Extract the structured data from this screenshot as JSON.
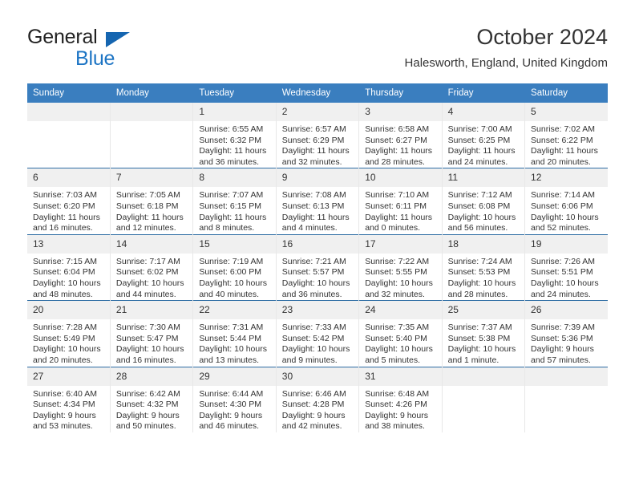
{
  "brand": {
    "name_part1": "General",
    "name_part2": "Blue",
    "triangle_color": "#1565b0",
    "blue_color": "#1c74c4"
  },
  "header": {
    "title": "October 2024",
    "subtitle": "Halesworth, England, United Kingdom",
    "header_bg": "#3a7ebf",
    "row_rule_color": "#2e6da4",
    "daynum_bg": "#f0f0f0"
  },
  "weekdays": [
    "Sunday",
    "Monday",
    "Tuesday",
    "Wednesday",
    "Thursday",
    "Friday",
    "Saturday"
  ],
  "weeks": [
    [
      {
        "day": "",
        "empty": true
      },
      {
        "day": "",
        "empty": true
      },
      {
        "day": "1",
        "sunrise": "Sunrise: 6:55 AM",
        "sunset": "Sunset: 6:32 PM",
        "daylight1": "Daylight: 11 hours",
        "daylight2": "and 36 minutes."
      },
      {
        "day": "2",
        "sunrise": "Sunrise: 6:57 AM",
        "sunset": "Sunset: 6:29 PM",
        "daylight1": "Daylight: 11 hours",
        "daylight2": "and 32 minutes."
      },
      {
        "day": "3",
        "sunrise": "Sunrise: 6:58 AM",
        "sunset": "Sunset: 6:27 PM",
        "daylight1": "Daylight: 11 hours",
        "daylight2": "and 28 minutes."
      },
      {
        "day": "4",
        "sunrise": "Sunrise: 7:00 AM",
        "sunset": "Sunset: 6:25 PM",
        "daylight1": "Daylight: 11 hours",
        "daylight2": "and 24 minutes."
      },
      {
        "day": "5",
        "sunrise": "Sunrise: 7:02 AM",
        "sunset": "Sunset: 6:22 PM",
        "daylight1": "Daylight: 11 hours",
        "daylight2": "and 20 minutes."
      }
    ],
    [
      {
        "day": "6",
        "sunrise": "Sunrise: 7:03 AM",
        "sunset": "Sunset: 6:20 PM",
        "daylight1": "Daylight: 11 hours",
        "daylight2": "and 16 minutes."
      },
      {
        "day": "7",
        "sunrise": "Sunrise: 7:05 AM",
        "sunset": "Sunset: 6:18 PM",
        "daylight1": "Daylight: 11 hours",
        "daylight2": "and 12 minutes."
      },
      {
        "day": "8",
        "sunrise": "Sunrise: 7:07 AM",
        "sunset": "Sunset: 6:15 PM",
        "daylight1": "Daylight: 11 hours",
        "daylight2": "and 8 minutes."
      },
      {
        "day": "9",
        "sunrise": "Sunrise: 7:08 AM",
        "sunset": "Sunset: 6:13 PM",
        "daylight1": "Daylight: 11 hours",
        "daylight2": "and 4 minutes."
      },
      {
        "day": "10",
        "sunrise": "Sunrise: 7:10 AM",
        "sunset": "Sunset: 6:11 PM",
        "daylight1": "Daylight: 11 hours",
        "daylight2": "and 0 minutes."
      },
      {
        "day": "11",
        "sunrise": "Sunrise: 7:12 AM",
        "sunset": "Sunset: 6:08 PM",
        "daylight1": "Daylight: 10 hours",
        "daylight2": "and 56 minutes."
      },
      {
        "day": "12",
        "sunrise": "Sunrise: 7:14 AM",
        "sunset": "Sunset: 6:06 PM",
        "daylight1": "Daylight: 10 hours",
        "daylight2": "and 52 minutes."
      }
    ],
    [
      {
        "day": "13",
        "sunrise": "Sunrise: 7:15 AM",
        "sunset": "Sunset: 6:04 PM",
        "daylight1": "Daylight: 10 hours",
        "daylight2": "and 48 minutes."
      },
      {
        "day": "14",
        "sunrise": "Sunrise: 7:17 AM",
        "sunset": "Sunset: 6:02 PM",
        "daylight1": "Daylight: 10 hours",
        "daylight2": "and 44 minutes."
      },
      {
        "day": "15",
        "sunrise": "Sunrise: 7:19 AM",
        "sunset": "Sunset: 6:00 PM",
        "daylight1": "Daylight: 10 hours",
        "daylight2": "and 40 minutes."
      },
      {
        "day": "16",
        "sunrise": "Sunrise: 7:21 AM",
        "sunset": "Sunset: 5:57 PM",
        "daylight1": "Daylight: 10 hours",
        "daylight2": "and 36 minutes."
      },
      {
        "day": "17",
        "sunrise": "Sunrise: 7:22 AM",
        "sunset": "Sunset: 5:55 PM",
        "daylight1": "Daylight: 10 hours",
        "daylight2": "and 32 minutes."
      },
      {
        "day": "18",
        "sunrise": "Sunrise: 7:24 AM",
        "sunset": "Sunset: 5:53 PM",
        "daylight1": "Daylight: 10 hours",
        "daylight2": "and 28 minutes."
      },
      {
        "day": "19",
        "sunrise": "Sunrise: 7:26 AM",
        "sunset": "Sunset: 5:51 PM",
        "daylight1": "Daylight: 10 hours",
        "daylight2": "and 24 minutes."
      }
    ],
    [
      {
        "day": "20",
        "sunrise": "Sunrise: 7:28 AM",
        "sunset": "Sunset: 5:49 PM",
        "daylight1": "Daylight: 10 hours",
        "daylight2": "and 20 minutes."
      },
      {
        "day": "21",
        "sunrise": "Sunrise: 7:30 AM",
        "sunset": "Sunset: 5:47 PM",
        "daylight1": "Daylight: 10 hours",
        "daylight2": "and 16 minutes."
      },
      {
        "day": "22",
        "sunrise": "Sunrise: 7:31 AM",
        "sunset": "Sunset: 5:44 PM",
        "daylight1": "Daylight: 10 hours",
        "daylight2": "and 13 minutes."
      },
      {
        "day": "23",
        "sunrise": "Sunrise: 7:33 AM",
        "sunset": "Sunset: 5:42 PM",
        "daylight1": "Daylight: 10 hours",
        "daylight2": "and 9 minutes."
      },
      {
        "day": "24",
        "sunrise": "Sunrise: 7:35 AM",
        "sunset": "Sunset: 5:40 PM",
        "daylight1": "Daylight: 10 hours",
        "daylight2": "and 5 minutes."
      },
      {
        "day": "25",
        "sunrise": "Sunrise: 7:37 AM",
        "sunset": "Sunset: 5:38 PM",
        "daylight1": "Daylight: 10 hours",
        "daylight2": "and 1 minute."
      },
      {
        "day": "26",
        "sunrise": "Sunrise: 7:39 AM",
        "sunset": "Sunset: 5:36 PM",
        "daylight1": "Daylight: 9 hours",
        "daylight2": "and 57 minutes."
      }
    ],
    [
      {
        "day": "27",
        "sunrise": "Sunrise: 6:40 AM",
        "sunset": "Sunset: 4:34 PM",
        "daylight1": "Daylight: 9 hours",
        "daylight2": "and 53 minutes."
      },
      {
        "day": "28",
        "sunrise": "Sunrise: 6:42 AM",
        "sunset": "Sunset: 4:32 PM",
        "daylight1": "Daylight: 9 hours",
        "daylight2": "and 50 minutes."
      },
      {
        "day": "29",
        "sunrise": "Sunrise: 6:44 AM",
        "sunset": "Sunset: 4:30 PM",
        "daylight1": "Daylight: 9 hours",
        "daylight2": "and 46 minutes."
      },
      {
        "day": "30",
        "sunrise": "Sunrise: 6:46 AM",
        "sunset": "Sunset: 4:28 PM",
        "daylight1": "Daylight: 9 hours",
        "daylight2": "and 42 minutes."
      },
      {
        "day": "31",
        "sunrise": "Sunrise: 6:48 AM",
        "sunset": "Sunset: 4:26 PM",
        "daylight1": "Daylight: 9 hours",
        "daylight2": "and 38 minutes."
      },
      {
        "day": "",
        "empty": true
      },
      {
        "day": "",
        "empty": true
      }
    ]
  ]
}
